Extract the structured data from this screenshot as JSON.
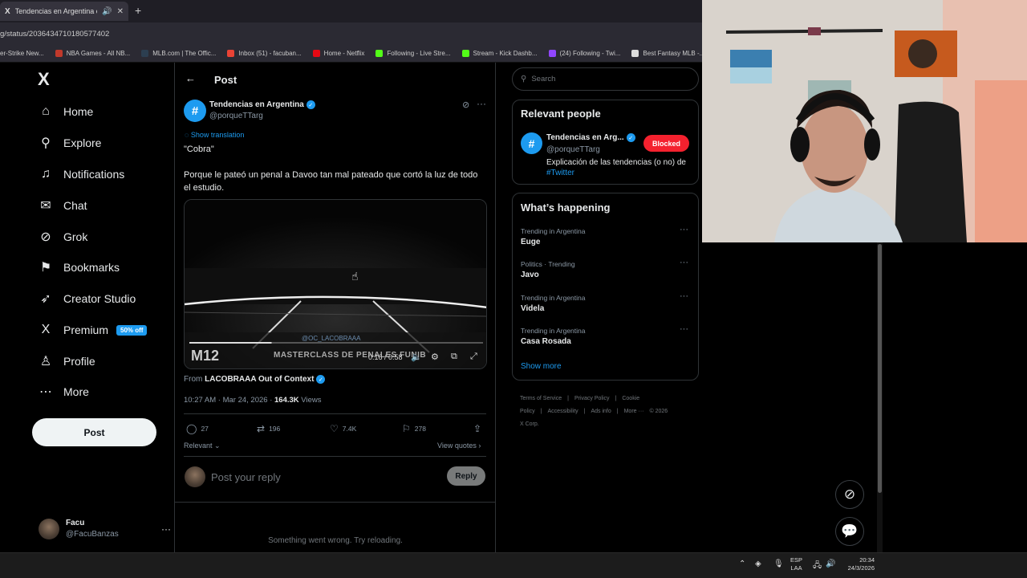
{
  "browser": {
    "tab_title": "Tendencias en Argentina o",
    "tab_logo": "X",
    "speaker_icon": "🔊",
    "close_icon": "✕",
    "new_tab_icon": "+",
    "url": "g/status/2036434710180577402",
    "bookmarks": [
      {
        "label": "er-Strike New...",
        "color": "#d35400"
      },
      {
        "label": "NBA Games - All NB...",
        "color": "#c0392b"
      },
      {
        "label": "MLB.com | The Offic...",
        "color": "#2c3e50"
      },
      {
        "label": "Inbox (51) - facuban...",
        "color": "#ea4335"
      },
      {
        "label": "Home - Netflix",
        "color": "#e50914"
      },
      {
        "label": "Following - Live Stre...",
        "color": "#53fc18"
      },
      {
        "label": "Stream - Kick Dashb...",
        "color": "#53fc18"
      },
      {
        "label": "(24) Following - Twi...",
        "color": "#9146ff"
      },
      {
        "label": "Best Fantasy MLB -...",
        "color": "#dddddd"
      }
    ]
  },
  "sidebar": {
    "logo": "X",
    "items": [
      {
        "label": "Home",
        "icon": "⌂"
      },
      {
        "label": "Explore",
        "icon": "⚲"
      },
      {
        "label": "Notifications",
        "icon": "♫"
      },
      {
        "label": "Chat",
        "icon": "✉"
      },
      {
        "label": "Grok",
        "icon": "⊘"
      },
      {
        "label": "Bookmarks",
        "icon": "⚑"
      },
      {
        "label": "Creator Studio",
        "icon": "➶"
      },
      {
        "label": "Premium",
        "icon": "X",
        "badge": "50% off"
      },
      {
        "label": "Profile",
        "icon": "♙"
      },
      {
        "label": "More",
        "icon": "⋯"
      }
    ],
    "post_button": "Post",
    "account": {
      "name": "Facu",
      "handle": "@FacuBanzas",
      "more": "···"
    }
  },
  "main": {
    "back_icon": "←",
    "title": "Post",
    "author": {
      "name": "Tendencias en Argentina",
      "handle": "@porqueTTarg",
      "avatar": "#",
      "verified": "✓"
    },
    "grok_icon": "⊘",
    "more_icon": "···",
    "show_translation": "Show translation",
    "text": "\"Cobra\"\n\nPorque le pateó un penal a Davoo tan mal pateado que cortó la luz de todo el estudio.",
    "video": {
      "overlay_text": "MASTERCLASS DE PENALES FUNIB",
      "watermark": "@OC_LACOBRAAA",
      "logo": "M12",
      "time": "0:16 / 0:58",
      "progress": 0.28
    },
    "from": {
      "prefix": "From",
      "account": "LACOBRAAA Out of Context"
    },
    "meta": {
      "time": "10:27 AM · Mar 24, 2026 · ",
      "views_count": "164.3K",
      "views_label": " Views"
    },
    "actions": [
      {
        "icon": "◯",
        "count": "27"
      },
      {
        "icon": "⇄",
        "count": "196"
      },
      {
        "icon": "♡",
        "count": "7.4K"
      },
      {
        "icon": "⚐",
        "count": "278"
      },
      {
        "icon": "⇪",
        "count": ""
      }
    ],
    "relevant": "Relevant ⌄",
    "view_quotes": "View quotes ›",
    "reply_placeholder": "Post your reply",
    "reply_button": "Reply",
    "error": "Something went wrong. Try reloading."
  },
  "right": {
    "search_placeholder": "Search",
    "relevant_people": {
      "title": "Relevant people",
      "name": "Tendencias en Arg...",
      "handle": "@porqueTTarg",
      "button": "Blocked",
      "bio": "Explicación de las tendencias (o no) de ",
      "bio_tag": "#Twitter"
    },
    "happening": {
      "title": "What’s happening",
      "trends": [
        {
          "context": "Trending in Argentina",
          "name": "Euge"
        },
        {
          "context": "Politics · Trending",
          "name": "Javo"
        },
        {
          "context": "Trending in Argentina",
          "name": "Videla"
        },
        {
          "context": "Trending in Argentina",
          "name": "Casa Rosada"
        }
      ],
      "show_more": "Show more"
    },
    "footer": [
      "Terms of Service",
      "|",
      "Privacy Policy",
      "|",
      "Cookie Policy",
      "|",
      "Accessibility",
      "|",
      "Ads info",
      "|",
      "More ···",
      "© 2026 X Corp."
    ]
  },
  "taskbar": {
    "lang_top": "ESP",
    "lang_bottom": "LAA",
    "time": "20:34",
    "date": "24/3/2026"
  }
}
